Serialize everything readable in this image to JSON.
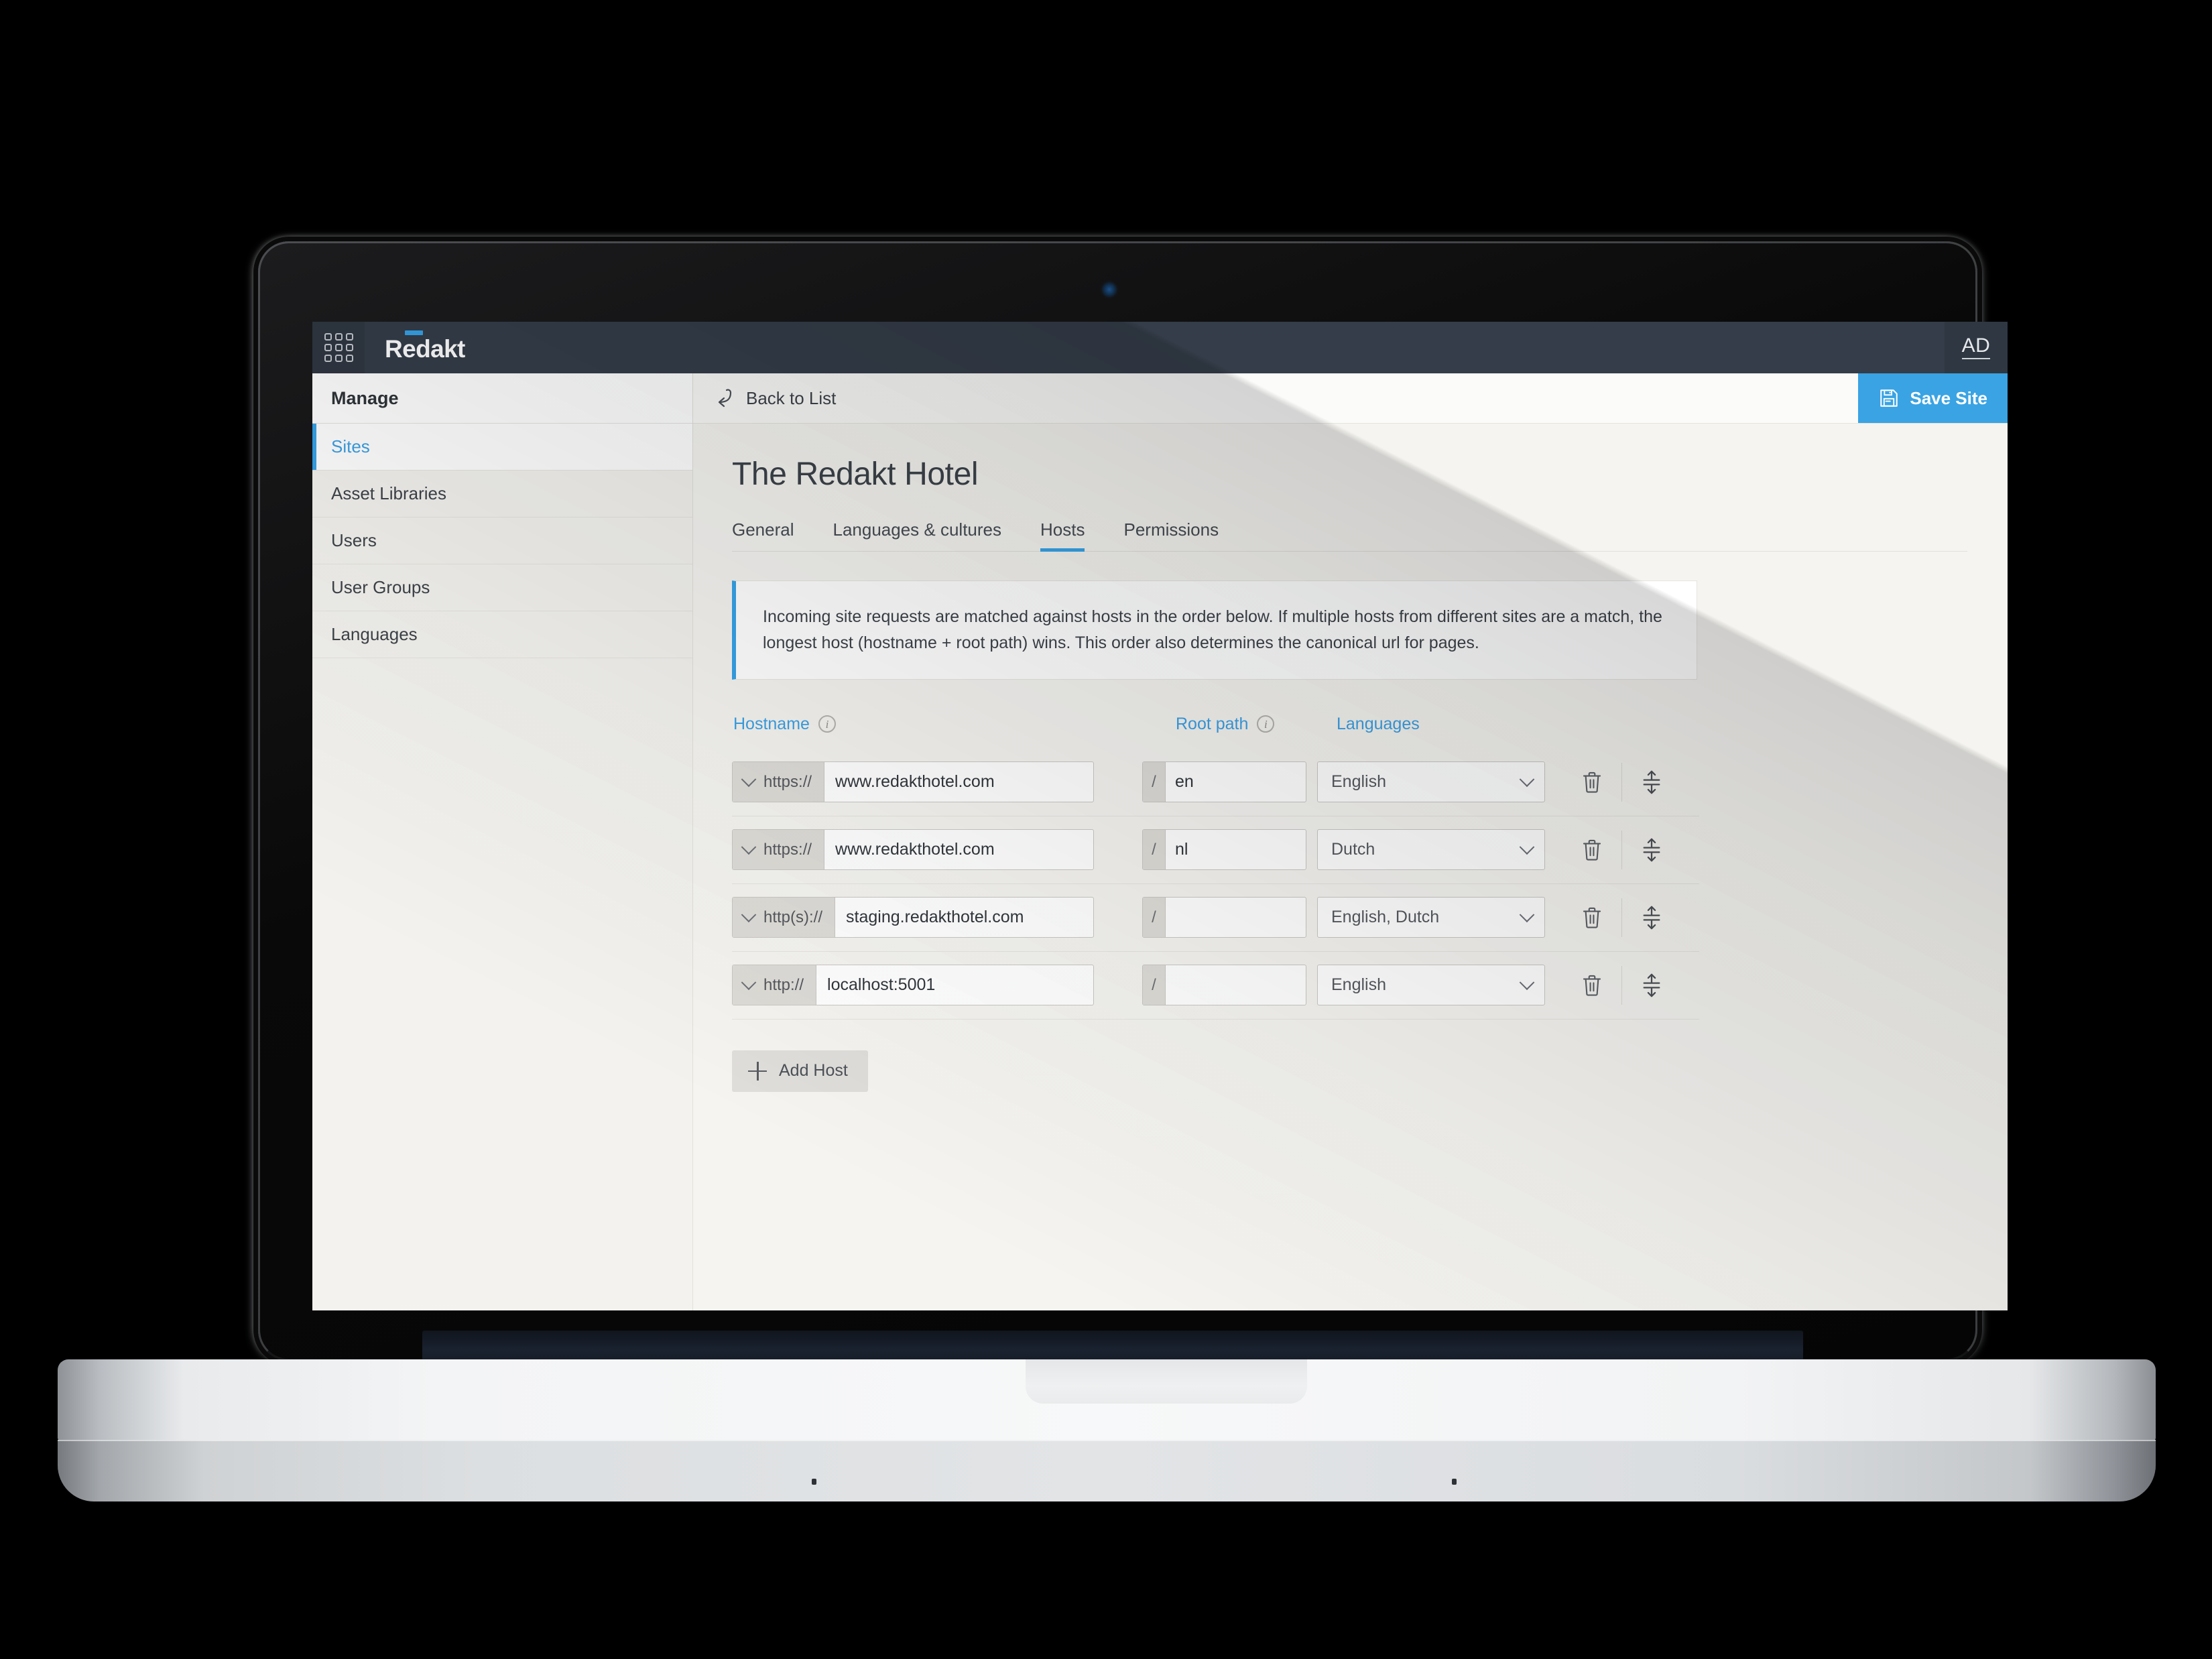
{
  "app": {
    "brand": "Redakt",
    "apps_icon": "grid-apps-icon",
    "avatar_initials": "AD"
  },
  "sidebar": {
    "header": "Manage",
    "items": [
      {
        "label": "Sites",
        "active": true
      },
      {
        "label": "Asset Libraries",
        "active": false
      },
      {
        "label": "Users",
        "active": false
      },
      {
        "label": "User Groups",
        "active": false
      },
      {
        "label": "Languages",
        "active": false
      }
    ]
  },
  "toolbar": {
    "back_label": "Back to List",
    "back_icon": "return-arrow-icon",
    "save_label": "Save Site",
    "save_icon": "floppy-save-icon"
  },
  "page": {
    "title": "The Redakt Hotel",
    "tabs": [
      {
        "label": "General",
        "active": false
      },
      {
        "label": "Languages & cultures",
        "active": false
      },
      {
        "label": "Hosts",
        "active": true
      },
      {
        "label": "Permissions",
        "active": false
      }
    ],
    "info_message": "Incoming site requests are matched against hosts in the order below. If multiple hosts from different sites are a match, the longest host (hostname + root path) wins. This order also determines the canonical url for pages."
  },
  "hosts_table": {
    "columns": {
      "hostname": "Hostname",
      "root_path": "Root path",
      "languages": "Languages"
    },
    "root_path_prefix": "/",
    "rows": [
      {
        "scheme": "https://",
        "hostname": "www.redakthotel.com",
        "root_path": "en",
        "languages": "English"
      },
      {
        "scheme": "https://",
        "hostname": "www.redakthotel.com",
        "root_path": "nl",
        "languages": "Dutch"
      },
      {
        "scheme": "http(s)://",
        "hostname": "staging.redakthotel.com",
        "root_path": "",
        "languages": "English, Dutch"
      },
      {
        "scheme": "http://",
        "hostname": "localhost:5001",
        "root_path": "",
        "languages": "English"
      }
    ],
    "row_actions": {
      "delete_icon": "trash-icon",
      "reorder_icon": "drag-reorder-icon"
    },
    "add_label": "Add Host",
    "add_icon": "plus-icon"
  },
  "colors": {
    "accent": "#35a3e8",
    "topbar": "#343d49",
    "content_bg": "#f5f4f0"
  }
}
